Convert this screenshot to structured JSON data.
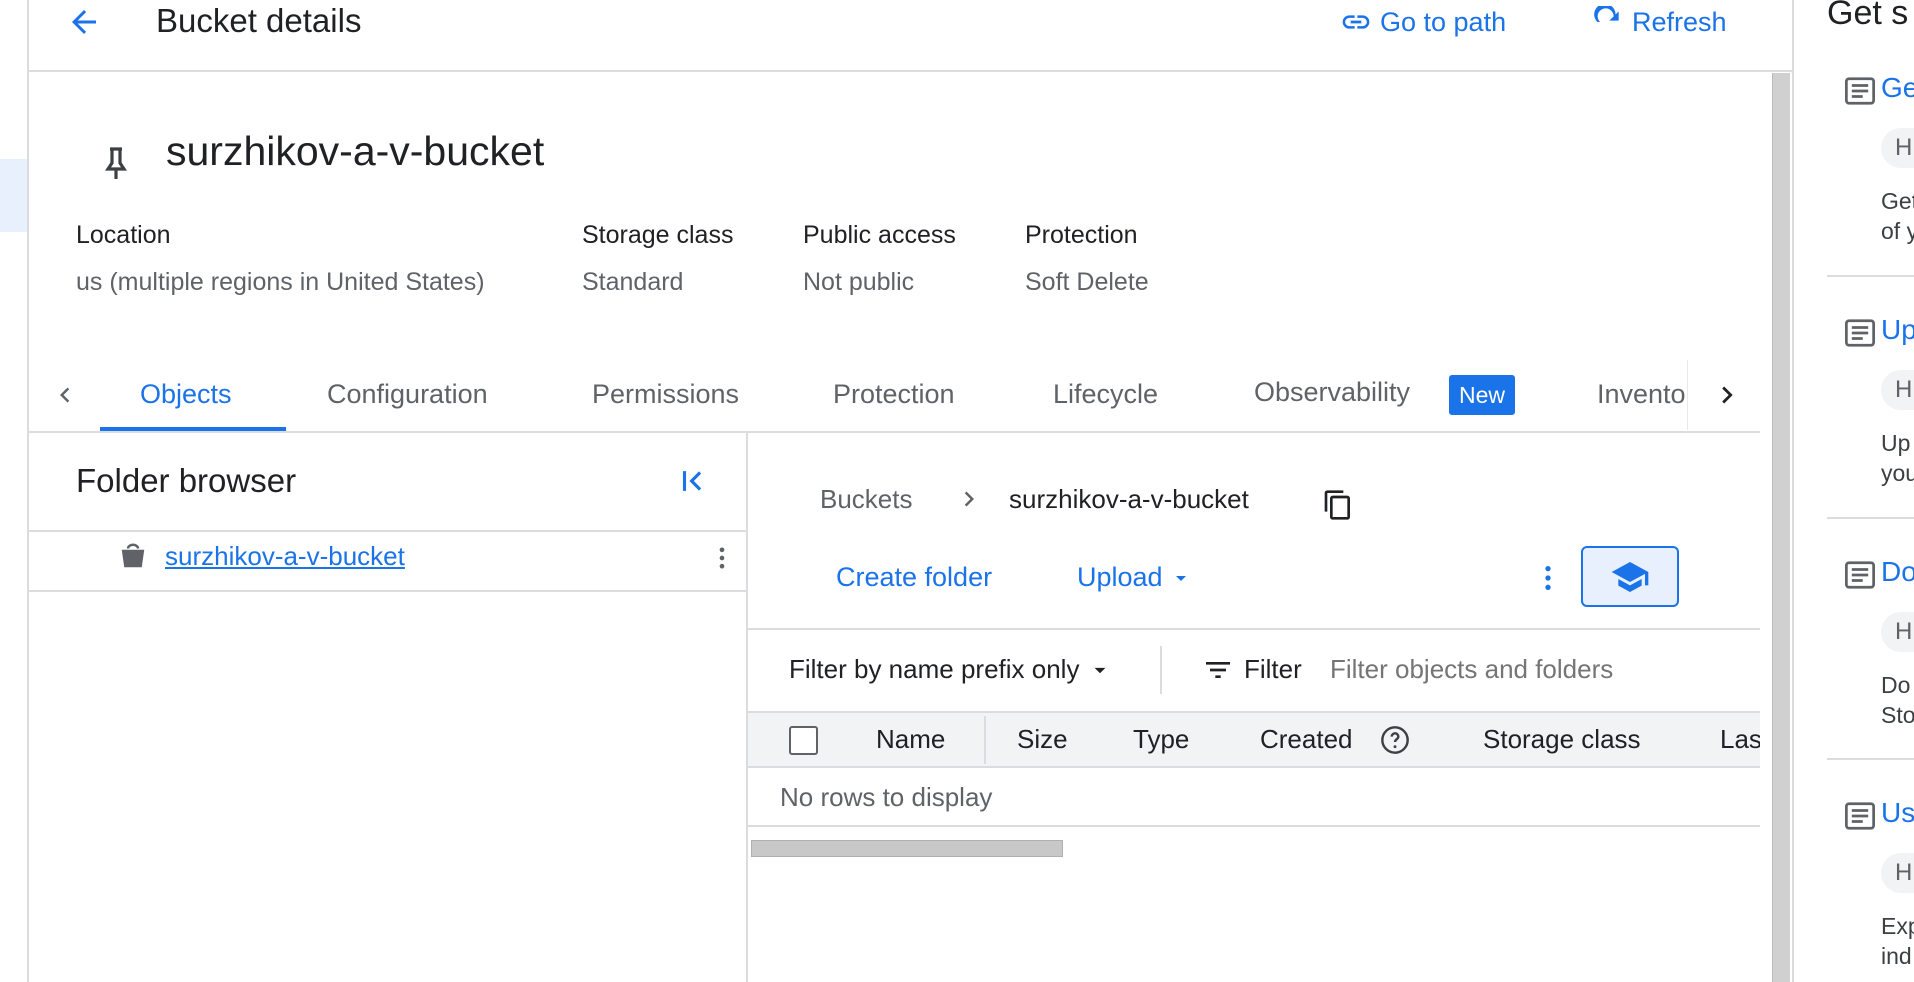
{
  "header": {
    "title": "Bucket details",
    "go_to_path": "Go to path",
    "refresh": "Refresh"
  },
  "bucket": {
    "name": "surzhikov-a-v-bucket",
    "fields": [
      {
        "label": "Location",
        "value": "us (multiple regions in United States)"
      },
      {
        "label": "Storage class",
        "value": "Standard"
      },
      {
        "label": "Public access",
        "value": "Not public"
      },
      {
        "label": "Protection",
        "value": "Soft Delete"
      }
    ]
  },
  "tabs": [
    {
      "label": "Objects",
      "active": true
    },
    {
      "label": "Configuration"
    },
    {
      "label": "Permissions"
    },
    {
      "label": "Protection"
    },
    {
      "label": "Lifecycle"
    },
    {
      "label": "Observability",
      "badge": "New"
    },
    {
      "label": "Invento"
    }
  ],
  "folder_browser": {
    "title": "Folder browser",
    "items": [
      {
        "label": "surzhikov-a-v-bucket"
      }
    ]
  },
  "objects": {
    "breadcrumb": [
      "Buckets",
      "surzhikov-a-v-bucket"
    ],
    "create_folder": "Create folder",
    "upload": "Upload",
    "filter_mode": "Filter by name prefix only",
    "filter_label": "Filter",
    "filter_placeholder": "Filter objects and folders",
    "columns": [
      "Name",
      "Size",
      "Type",
      "Created",
      "Storage class",
      "Las"
    ],
    "empty": "No rows to display"
  },
  "side_panel": {
    "title": "Get s",
    "items": [
      {
        "title": "Ge",
        "chip": "H",
        "desc": [
          "Get",
          "of y"
        ]
      },
      {
        "title": "Up",
        "chip": "H",
        "desc": [
          "Up",
          "you"
        ]
      },
      {
        "title": "Do",
        "chip": "H",
        "desc": [
          "Do",
          "Sto"
        ]
      },
      {
        "title": "Us",
        "chip": "H",
        "desc": [
          "Exp",
          "ind"
        ]
      }
    ]
  },
  "colors": {
    "accent": "#1a73e8",
    "badge_bg": "#1a73e8",
    "divider": "#dadce0"
  }
}
